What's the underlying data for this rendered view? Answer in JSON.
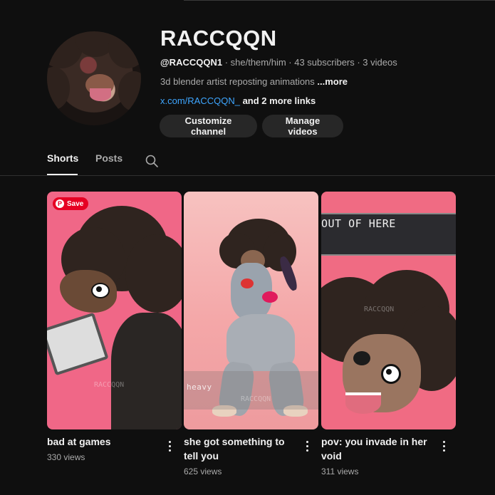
{
  "channel": {
    "name": "RACCQQN",
    "handle": "@RACCQQN1",
    "meta_rest": " · she/them/him · 43 subscribers · 3 videos",
    "description": "3d blender artist reposting animations ",
    "more_label": "...more",
    "link": "x.com/RACCQQN_",
    "more_links": " and 2 more links"
  },
  "buttons": {
    "customize": "Customize channel",
    "manage": "Manage videos"
  },
  "tabs": {
    "shorts": "Shorts",
    "posts": "Posts"
  },
  "shorts": [
    {
      "title_line1": "bad at games",
      "title_line2": "",
      "views": "330 views",
      "save_label": "Save",
      "watermark": "RACCQQN"
    },
    {
      "title_line1": "she got something to",
      "title_line2": "tell you",
      "views": "625 views",
      "overlay": "heavy",
      "watermark": "RACCQQN"
    },
    {
      "title_line1": "pov: you invade in her",
      "title_line2": "void",
      "views": "311 views",
      "overlay": "OUT OF HERE",
      "watermark": "RACCQQN"
    }
  ],
  "icons": [
    "search-icon",
    "more-vert-icon",
    "pinterest-icon"
  ],
  "colors": {
    "background": "#0f0f0f",
    "link": "#3ea6ff",
    "button": "#272727",
    "pinterest": "#e60023"
  }
}
